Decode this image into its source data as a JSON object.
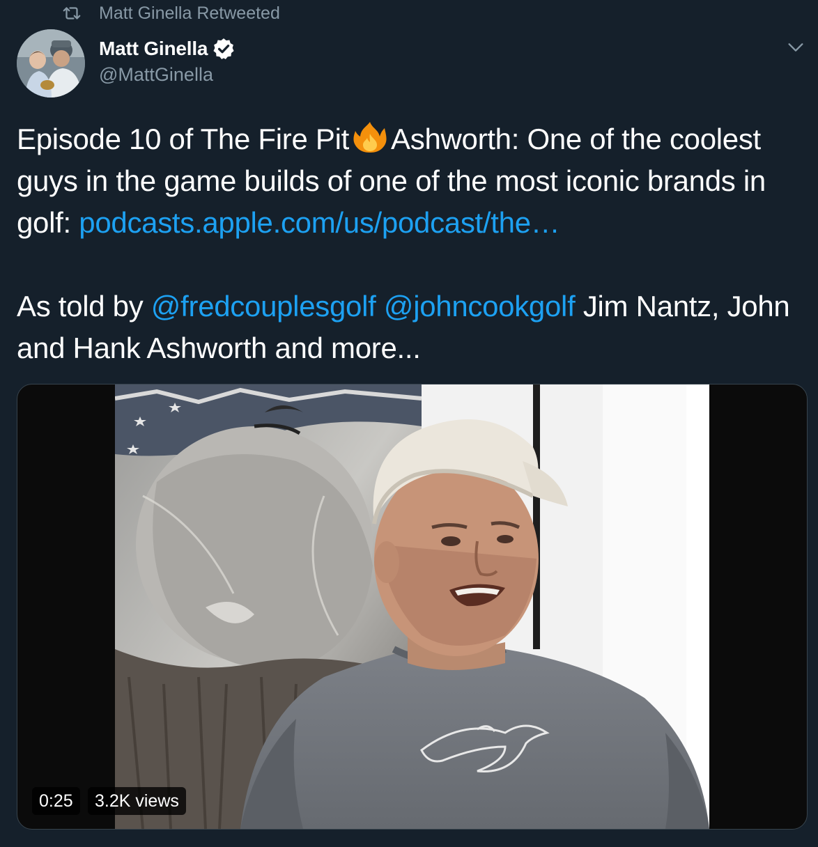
{
  "retweet_context": {
    "icon": "retweet-icon",
    "label": "Matt Ginella Retweeted"
  },
  "author": {
    "display_name": "Matt Ginella",
    "handle": "@MattGinella",
    "verified": true,
    "avatar_icon": "avatar-photo"
  },
  "menu": {
    "icon": "chevron-down-icon"
  },
  "tweet": {
    "line1_part1": "Episode 10 of The Fire Pit",
    "emoji": "fire-emoji",
    "line1_part2": "Ashworth: One of the coolest guys in the game builds of one of the most iconic brands in golf: ",
    "link_url": "podcasts.apple.com/us/podcast/the…",
    "para2_prefix": "As told by ",
    "mention1": "@fredcouplesgolf",
    "mention2": "@johncookgolf",
    "para2_suffix": " Jim Nantz, John and Hank Ashworth and more..."
  },
  "media": {
    "duration": "0:25",
    "views": "3.2K views"
  },
  "colors": {
    "background": "#15202b",
    "link": "#1da1f2",
    "secondary_text": "#8899a6",
    "verified": "#ffffff"
  }
}
